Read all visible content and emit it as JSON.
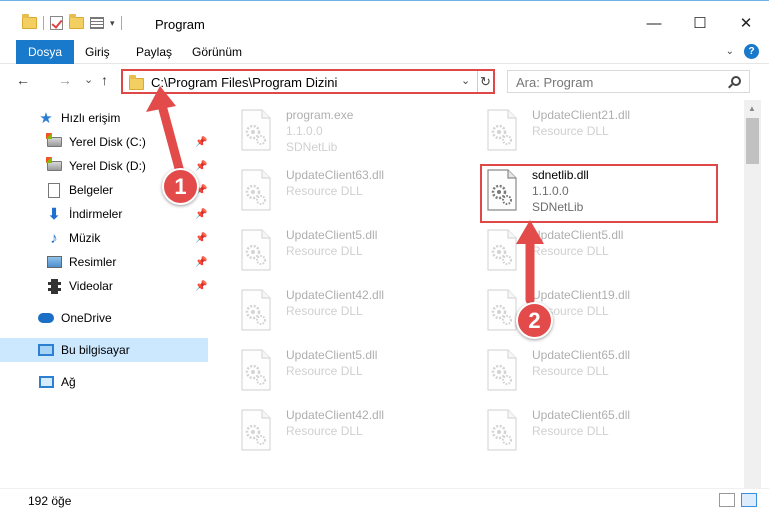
{
  "window": {
    "title": "Program",
    "minimize_glyph": "—",
    "maximize_glyph": "☐",
    "close_glyph": "✕"
  },
  "ribbon": {
    "tabs": [
      {
        "label": "Dosya",
        "active": true
      },
      {
        "label": "Giriş",
        "active": false
      },
      {
        "label": "Paylaş",
        "active": false
      },
      {
        "label": "Görünüm",
        "active": false
      }
    ],
    "help_label": "?"
  },
  "navigation": {
    "back_glyph": "←",
    "forward_glyph": "→",
    "recent_glyph": "⌄",
    "up_glyph": "↑",
    "address": "C:\\Program Files\\Program Dizini",
    "search_placeholder": "Ara: Program"
  },
  "sidebar": {
    "items": [
      {
        "label": "Hızlı erişim",
        "icon": "star-icon",
        "pinned": false
      },
      {
        "label": "Yerel Disk (C:)",
        "icon": "drive-icon",
        "pinned": true
      },
      {
        "label": "Yerel Disk (D:)",
        "icon": "drive-icon",
        "pinned": true
      },
      {
        "label": "Belgeler",
        "icon": "document-icon",
        "pinned": true
      },
      {
        "label": "İndirmeler",
        "icon": "download-icon",
        "pinned": true
      },
      {
        "label": "Müzik",
        "icon": "music-icon",
        "pinned": true
      },
      {
        "label": "Resimler",
        "icon": "pictures-icon",
        "pinned": true
      },
      {
        "label": "Videolar",
        "icon": "video-icon",
        "pinned": true
      },
      {
        "label": "OneDrive",
        "icon": "cloud-icon",
        "pinned": false
      },
      {
        "label": "Bu bilgisayar",
        "icon": "computer-icon",
        "pinned": false,
        "selected": true
      },
      {
        "label": "Ağ",
        "icon": "network-icon",
        "pinned": false
      }
    ]
  },
  "files": [
    {
      "name": "program.exe",
      "line1": "1.1.0.0",
      "line2": "SDNetLib",
      "icon": "exe-icon",
      "faded": true
    },
    {
      "name": "UpdateClient21.dll",
      "line1": "Resource DLL",
      "line2": "",
      "icon": "dll-icon",
      "faded": true
    },
    {
      "name": "UpdateClient63.dll",
      "line1": "Resource DLL",
      "line2": "",
      "icon": "dll-icon",
      "faded": true
    },
    {
      "name": "sdnetlib.dll",
      "line1": "1.1.0.0",
      "line2": "SDNetLib",
      "icon": "dll-gear-icon",
      "faded": false
    },
    {
      "name": "UpdateClient5.dll",
      "line1": "Resource DLL",
      "line2": "",
      "icon": "dll-icon",
      "faded": true
    },
    {
      "name": "UpdateClient5.dll",
      "line1": "Resource DLL",
      "line2": "",
      "icon": "dll-icon",
      "faded": true
    },
    {
      "name": "UpdateClient42.dll",
      "line1": "Resource DLL",
      "line2": "",
      "icon": "dll-icon",
      "faded": true
    },
    {
      "name": "UpdateClient19.dll",
      "line1": "Resource DLL",
      "line2": "",
      "icon": "dll-icon",
      "faded": true
    },
    {
      "name": "UpdateClient5.dll",
      "line1": "Resource DLL",
      "line2": "",
      "icon": "dll-icon",
      "faded": true
    },
    {
      "name": "UpdateClient65.dll",
      "line1": "Resource DLL",
      "line2": "",
      "icon": "dll-icon",
      "faded": true
    },
    {
      "name": "UpdateClient42.dll",
      "line1": "Resource DLL",
      "line2": "",
      "icon": "dll-icon",
      "faded": true
    },
    {
      "name": "UpdateClient65.dll",
      "line1": "Resource DLL",
      "line2": "",
      "icon": "dll-icon",
      "faded": true
    }
  ],
  "status": {
    "item_count": "192 öğe"
  },
  "annotations": {
    "step1": "1",
    "step2": "2",
    "color": "#e04848"
  }
}
